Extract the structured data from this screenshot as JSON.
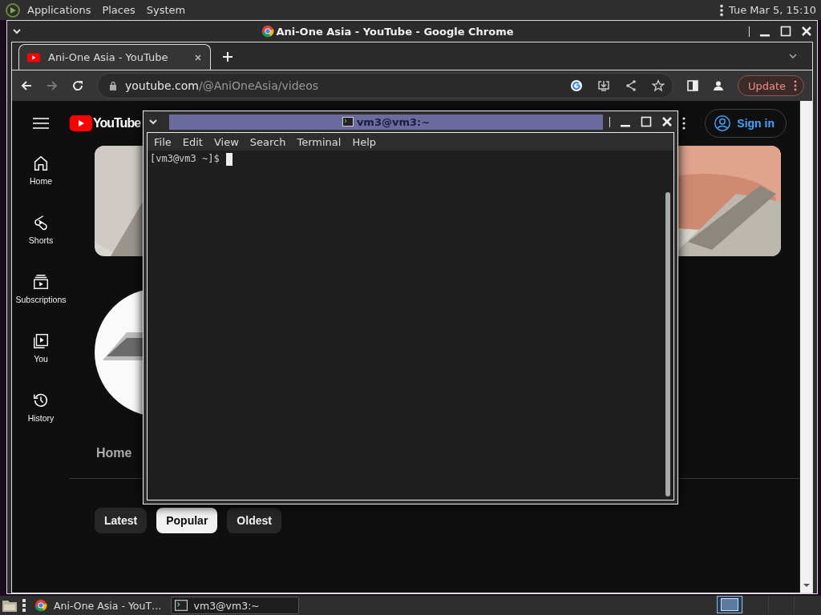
{
  "top_panel": {
    "menus": [
      "Applications",
      "Places",
      "System"
    ],
    "clock": "Tue Mar  5, 15:10"
  },
  "browser": {
    "window_title": "Ani-One Asia - YouTube - Google Chrome",
    "tabs": [
      {
        "label": "Ani-One Asia - YouTube",
        "selected": true
      }
    ],
    "address": {
      "domain": "youtube.com",
      "path": "/@AniOneAsia/videos"
    },
    "forward_disabled": true,
    "update_button": "Update"
  },
  "youtube": {
    "logo": "YouTube",
    "sign_in": "Sign in",
    "nav": [
      {
        "label": "Home"
      },
      {
        "label": "Shorts"
      },
      {
        "label": "Subscriptions"
      },
      {
        "label": "You"
      },
      {
        "label": "History"
      }
    ],
    "channel_tabs": [
      {
        "label": "Home",
        "selected": false
      }
    ],
    "chips": [
      {
        "label": "Latest",
        "selected": false
      },
      {
        "label": "Popular",
        "selected": true
      },
      {
        "label": "Oldest",
        "selected": false
      }
    ]
  },
  "terminal": {
    "title": "vm3@vm3:~",
    "menus": [
      "File",
      "Edit",
      "View",
      "Search",
      "Terminal",
      "Help"
    ],
    "prompt": "[vm3@vm3 ~]$"
  },
  "taskbar": {
    "tasks": [
      {
        "label": "Ani-One Asia - YouT…",
        "selected": false
      },
      {
        "label": "vm3@vm3:~",
        "selected": true
      }
    ],
    "workspaces": [
      {
        "selected": true
      },
      {
        "selected": false
      },
      {
        "selected": false
      },
      {
        "selected": false
      }
    ]
  }
}
